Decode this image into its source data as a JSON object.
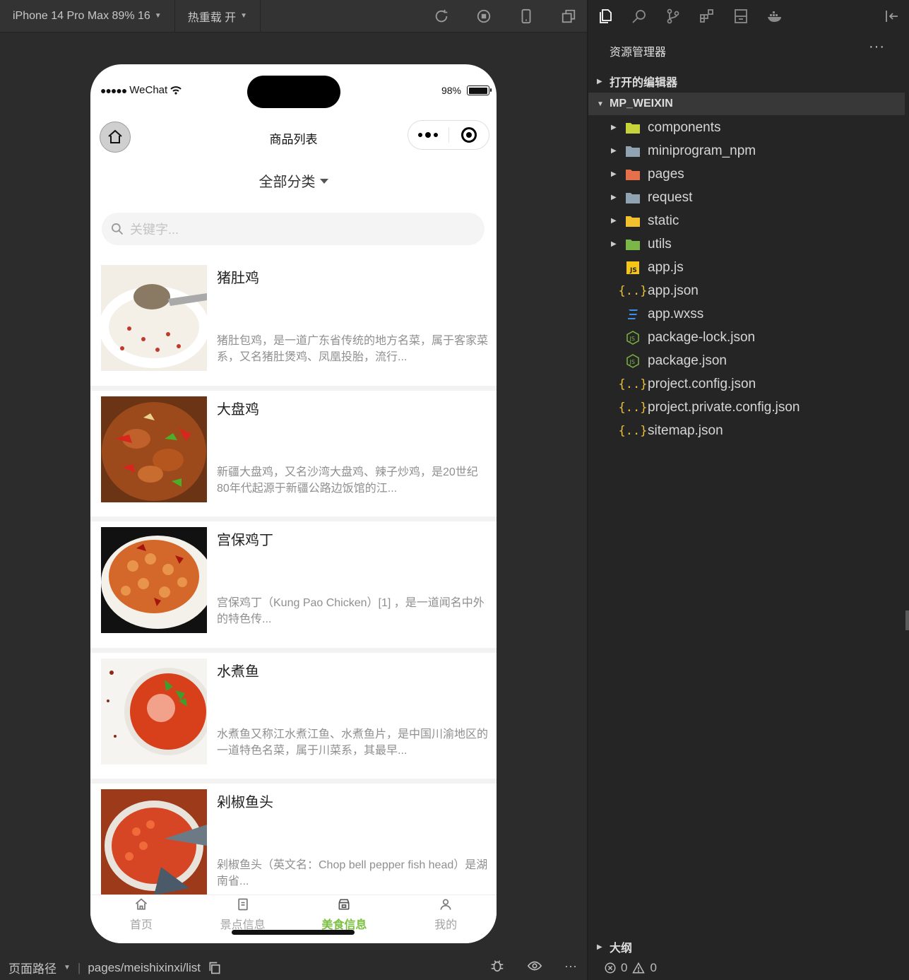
{
  "toolbar": {
    "device": "iPhone 14 Pro Max 89% 16",
    "hot_reload": "热重载 开"
  },
  "phone": {
    "carrier": "WeChat",
    "battery": "98%",
    "battery_level": 0.98,
    "nav_title": "商品列表",
    "category": "全部分类",
    "search_placeholder": "关键字..."
  },
  "items": [
    {
      "title": "猪肚鸡",
      "desc": "猪肚包鸡，是一道广东省传统的地方名菜，属于客家菜系，又名猪肚煲鸡、凤凰投胎，流行..."
    },
    {
      "title": "大盘鸡",
      "desc": "新疆大盘鸡，又名沙湾大盘鸡、辣子炒鸡，是20世纪80年代起源于新疆公路边饭馆的江..."
    },
    {
      "title": "宫保鸡丁",
      "desc": "宫保鸡丁（Kung Pao Chicken）[1] ，是一道闻名中外的特色传..."
    },
    {
      "title": "水煮鱼",
      "desc": "水煮鱼又称江水煮江鱼、水煮鱼片，是中国川渝地区的一道特色名菜，属于川菜系，其最早..."
    },
    {
      "title": "剁椒鱼头",
      "desc": "剁椒鱼头（英文名：Chop bell pepper fish head）是湖南省..."
    }
  ],
  "tabbar": {
    "tabs": [
      {
        "label": "首页",
        "icon": "home-icon"
      },
      {
        "label": "景点信息",
        "icon": "document-icon"
      },
      {
        "label": "美食信息",
        "icon": "store-icon"
      },
      {
        "label": "我的",
        "icon": "user-icon"
      }
    ],
    "active_color": "#7bc043"
  },
  "status": {
    "path_label": "页面路径",
    "path": "pages/meishixinxi/list"
  },
  "explorer": {
    "title": "资源管理器",
    "more": "···",
    "open_editors": "打开的编辑器",
    "project": "MP_WEIXIN",
    "files": [
      {
        "name": "components",
        "type": "folder",
        "icon": "components-folder-icon",
        "color": "#c7d33b"
      },
      {
        "name": "miniprogram_npm",
        "type": "folder",
        "icon": "folder-icon",
        "color": "#8fa3b3"
      },
      {
        "name": "pages",
        "type": "folder",
        "icon": "pages-folder-icon",
        "color": "#e5704a"
      },
      {
        "name": "request",
        "type": "folder",
        "icon": "folder-icon",
        "color": "#8fa3b3"
      },
      {
        "name": "static",
        "type": "folder",
        "icon": "static-folder-icon",
        "color": "#f2c12e"
      },
      {
        "name": "utils",
        "type": "folder",
        "icon": "utils-folder-icon",
        "color": "#7ab648"
      },
      {
        "name": "app.js",
        "type": "file",
        "icon": "js-file-icon",
        "color": "#f5c518"
      },
      {
        "name": "app.json",
        "type": "file",
        "icon": "json-file-icon",
        "color": "#e8c13c"
      },
      {
        "name": "app.wxss",
        "type": "file",
        "icon": "css-file-icon",
        "color": "#3c8ee8"
      },
      {
        "name": "package-lock.json",
        "type": "file",
        "icon": "nodejs-file-icon",
        "color": "#7cb342"
      },
      {
        "name": "package.json",
        "type": "file",
        "icon": "nodejs-file-icon",
        "color": "#7cb342"
      },
      {
        "name": "project.config.json",
        "type": "file",
        "icon": "json-file-icon",
        "color": "#e8c13c"
      },
      {
        "name": "project.private.config.json",
        "type": "file",
        "icon": "json-file-icon",
        "color": "#e8c13c"
      },
      {
        "name": "sitemap.json",
        "type": "file",
        "icon": "json-file-icon",
        "color": "#e8c13c"
      }
    ],
    "outline": "大纲",
    "errors": "0",
    "warnings": "0"
  }
}
